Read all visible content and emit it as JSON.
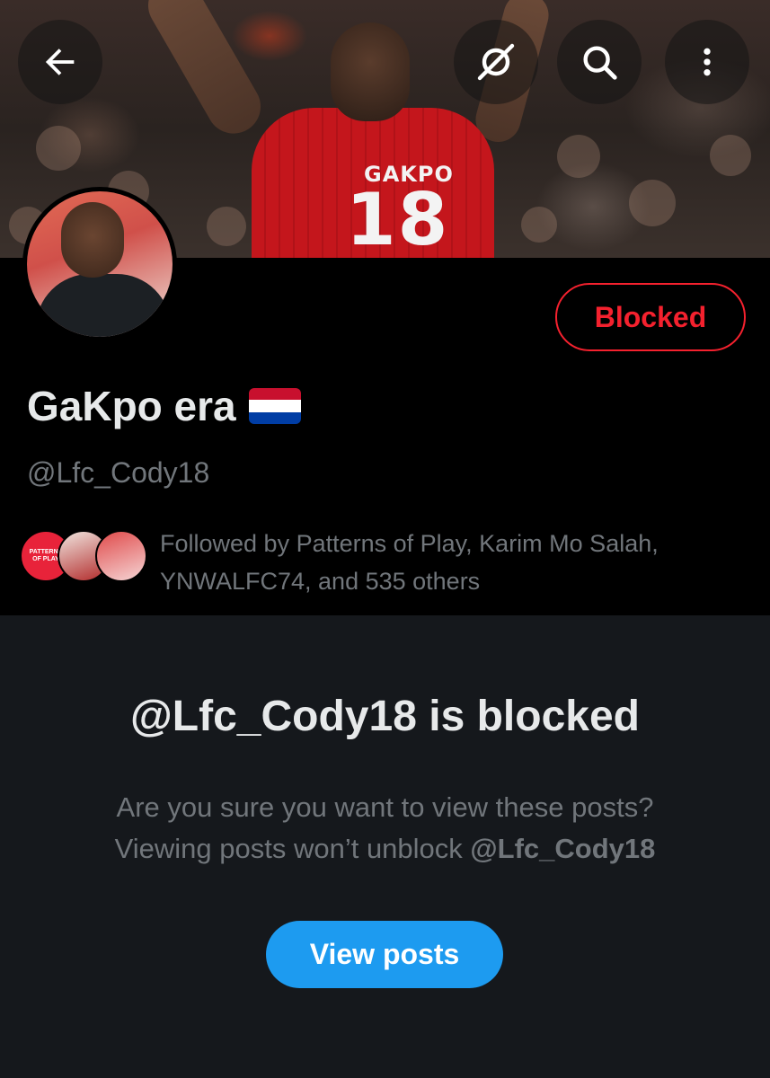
{
  "banner": {
    "shirt_name": "GAKPO",
    "shirt_number": "18",
    "icons": [
      "back-arrow-icon",
      "grok-icon",
      "search-icon",
      "more-vertical-icon"
    ]
  },
  "profile": {
    "display_name": "GaKpo era",
    "flag": "netherlands-flag",
    "handle": "@Lfc_Cody18",
    "blocked_label": "Blocked",
    "followed_by_text": "Followed by Patterns of Play, Karim Mo Salah, YNWALFC74, and 535 others",
    "follower_avatar_1_text": "PATTERNS OF PLAY"
  },
  "blocked_notice": {
    "title": "@Lfc_Cody18 is blocked",
    "line1": "Are you sure you want to view these posts?",
    "line2_prefix": "Viewing posts won’t unblock ",
    "line2_handle": "@Lfc_Cody18",
    "button_label": "View posts"
  },
  "colors": {
    "accent": "#1d9bf0",
    "danger": "#f4212e",
    "background": "#15181c",
    "header_bg": "#000000",
    "secondary_text": "#71767b"
  }
}
